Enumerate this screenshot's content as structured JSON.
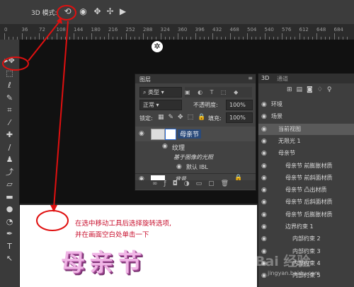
{
  "options_bar": {
    "mode_label": "3D 模式:"
  },
  "ruler": {
    "labels": [
      "0",
      "36",
      "72",
      "108",
      "144",
      "180",
      "216",
      "252",
      "288",
      "324",
      "360",
      "396",
      "432",
      "468",
      "504",
      "540",
      "576",
      "612",
      "648",
      "684"
    ]
  },
  "tools": [
    {
      "name": "move-tool-icon",
      "glyph": "▸✥"
    },
    {
      "name": "marquee-tool-icon",
      "glyph": "⬚"
    },
    {
      "name": "lasso-tool-icon",
      "glyph": "ℓ"
    },
    {
      "name": "quick-select-tool-icon",
      "glyph": "✎"
    },
    {
      "name": "crop-tool-icon",
      "glyph": "⌗"
    },
    {
      "name": "eyedropper-tool-icon",
      "glyph": "⁄"
    },
    {
      "name": "healing-tool-icon",
      "glyph": "✚"
    },
    {
      "name": "brush-tool-icon",
      "glyph": "∕"
    },
    {
      "name": "stamp-tool-icon",
      "glyph": "♟"
    },
    {
      "name": "history-brush-tool-icon",
      "glyph": "⤴"
    },
    {
      "name": "eraser-tool-icon",
      "glyph": "▱"
    },
    {
      "name": "gradient-tool-icon",
      "glyph": "▬"
    },
    {
      "name": "blur-tool-icon",
      "glyph": "●"
    },
    {
      "name": "dodge-tool-icon",
      "glyph": "◔"
    },
    {
      "name": "pen-tool-icon",
      "glyph": "✒"
    },
    {
      "name": "type-tool-icon",
      "glyph": "T"
    },
    {
      "name": "path-select-tool-icon",
      "glyph": "↖"
    }
  ],
  "layers_panel": {
    "tab": "图层",
    "filter_label": "类型",
    "blend_mode": "正常",
    "opacity_label": "不透明度:",
    "opacity_value": "100%",
    "lock_label": "锁定:",
    "fill_label": "填充:",
    "fill_value": "100%",
    "layers": [
      {
        "name": "母亲节",
        "kind": "3d"
      },
      {
        "name": "纹理",
        "kind": "sub"
      },
      {
        "name": "基于图像的光照",
        "kind": "sub2"
      },
      {
        "name": "默认 IBL",
        "kind": "sub3"
      },
      {
        "name": "背景",
        "kind": "bg"
      }
    ],
    "footer_icons": [
      "link-icon",
      "fx-icon",
      "mask-icon",
      "adjustment-icon",
      "folder-icon",
      "new-layer-icon",
      "trash-icon"
    ]
  },
  "panel_3d": {
    "tabs": [
      "3D",
      "通道"
    ],
    "items": [
      {
        "label": "环境",
        "indent": 1
      },
      {
        "label": "场景",
        "indent": 1
      },
      {
        "label": "当前视图",
        "indent": 2
      },
      {
        "label": "无限光 1",
        "indent": 2
      },
      {
        "label": "母亲节",
        "indent": 2
      },
      {
        "label": "母亲节 前膨胀材质",
        "indent": 3
      },
      {
        "label": "母亲节 前斜面材质",
        "indent": 3
      },
      {
        "label": "母亲节 凸出材质",
        "indent": 3
      },
      {
        "label": "母亲节 后斜面材质",
        "indent": 3
      },
      {
        "label": "母亲节 后膨胀材质",
        "indent": 3
      },
      {
        "label": "边界约束 1",
        "indent": 3
      },
      {
        "label": "内部约束 2",
        "indent": 4
      },
      {
        "label": "内部约束 3",
        "indent": 4
      },
      {
        "label": "内部约束 4",
        "indent": 4
      },
      {
        "label": "内部约束 5",
        "indent": 4
      }
    ]
  },
  "canvas": {
    "instruction_line1": "在选中移动工具后选择旋转选项,",
    "instruction_line2": "并在画面空白处单击一下",
    "title_text": "母亲节"
  },
  "watermark": {
    "text": "Bai 经验",
    "url": "jingyan.baidu.com"
  },
  "colors": {
    "annotation_red": "#e01010",
    "title_pink": "#f0b6e6"
  }
}
